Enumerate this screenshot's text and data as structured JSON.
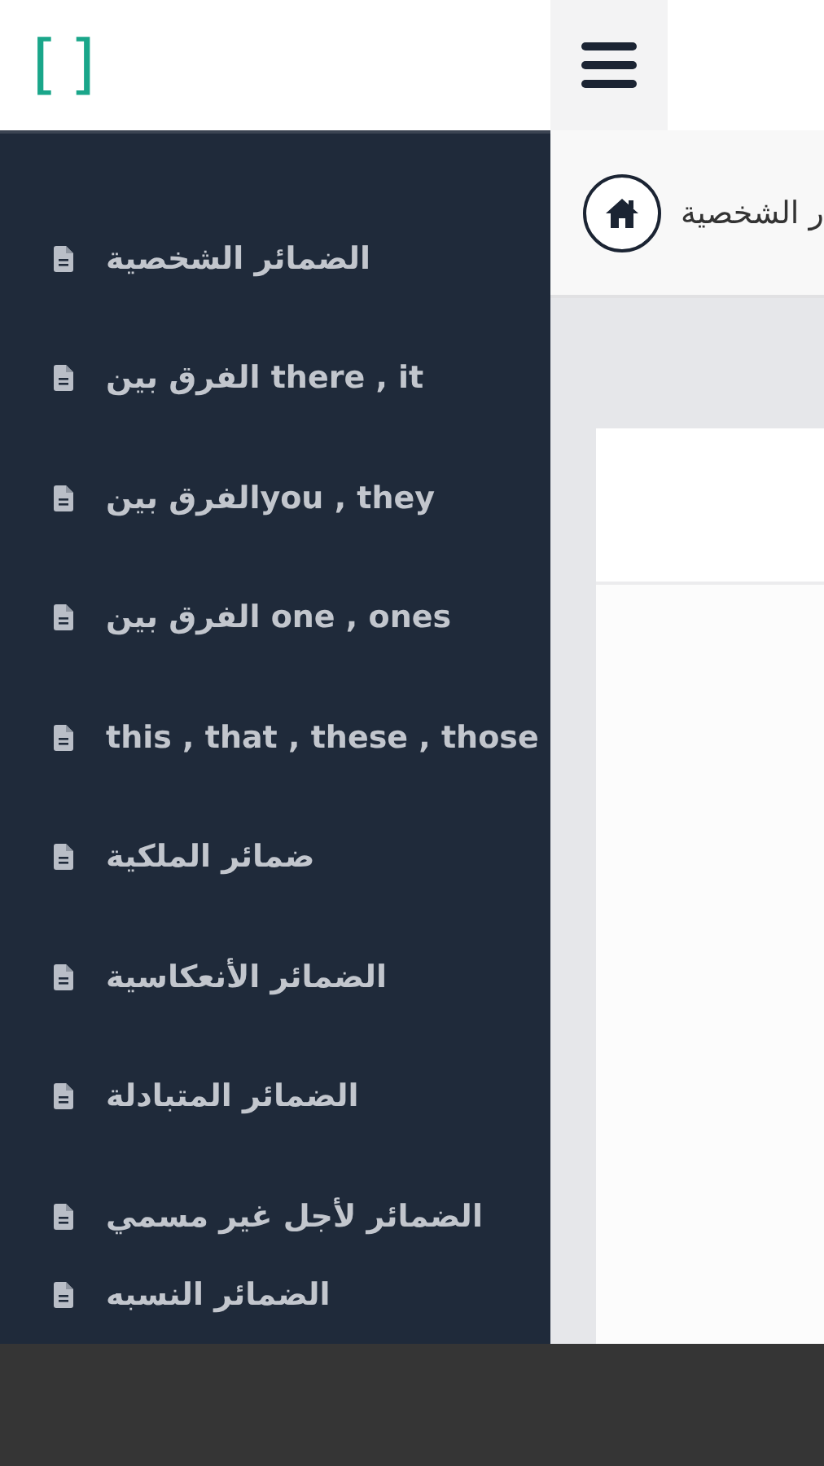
{
  "logo": "[]",
  "breadcrumb": {
    "text": "ر الشخصية"
  },
  "sidebar": {
    "items": [
      {
        "label": "الضمائر الشخصية"
      },
      {
        "label": "الفرق بين there , it"
      },
      {
        "label": "الفرق بينyou , they"
      },
      {
        "label": "الفرق بين one , ones"
      },
      {
        "label": "this , that , these , those"
      },
      {
        "label": "ضمائر الملكية"
      },
      {
        "label": "الضمائر الأنعكاسية"
      },
      {
        "label": "الضمائر المتبادلة"
      },
      {
        "label": "الضمائر لأجل غير مسمي"
      },
      {
        "label": "الضمائر النسبه"
      }
    ]
  }
}
